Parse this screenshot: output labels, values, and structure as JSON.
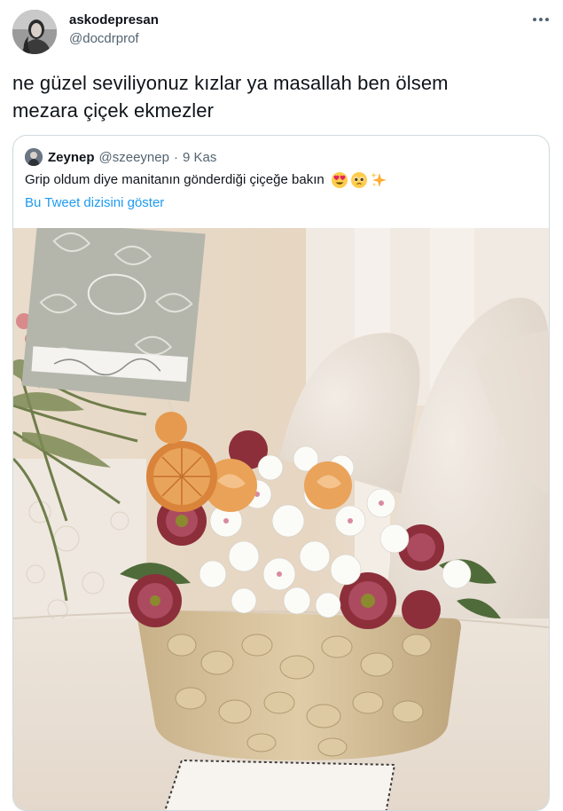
{
  "tweet": {
    "display_name": "askodepresan",
    "handle": "@docdrprof",
    "text": "ne güzel seviliyonuz kızlar ya masallah ben ölsem\nmezara çiçek ekmezler",
    "more_icon": "more-horizontal-icon"
  },
  "quoted_tweet": {
    "display_name": "Zeynep",
    "handle": "@szeeynep",
    "separator": "·",
    "date": "9 Kas",
    "text": "Grip oldum diye manitanın gönderdiği çiçeğe bakın",
    "emojis": [
      "heart-eyes-emoji",
      "pleading-face-emoji",
      "sparkles-emoji"
    ],
    "thread_link": "Bu Tweet dizisini göster"
  },
  "colors": {
    "text": "#0f1419",
    "secondary": "#536471",
    "link": "#1d9bf0",
    "border": "#cfd9de"
  }
}
